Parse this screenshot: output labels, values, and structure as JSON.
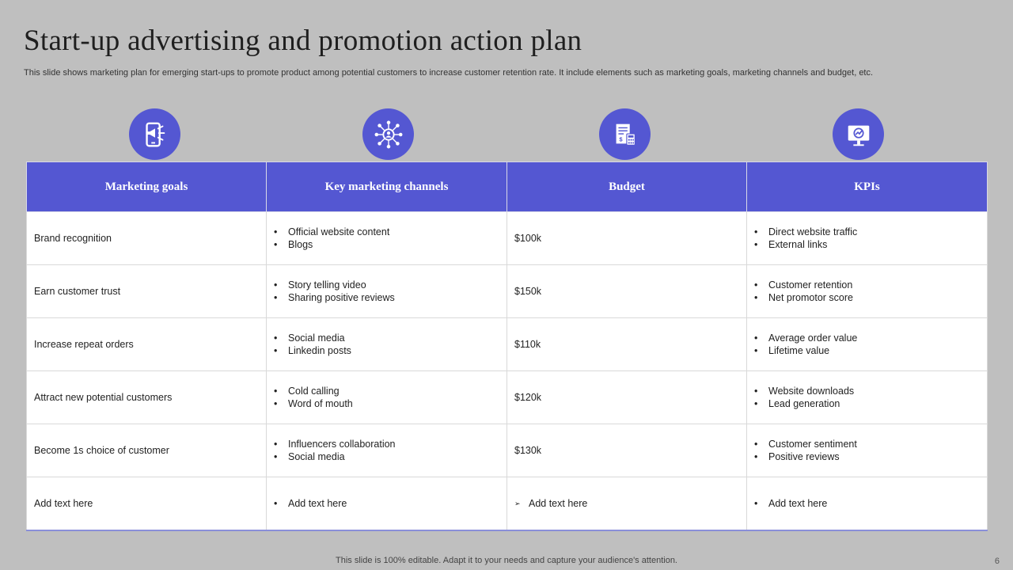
{
  "title": "Start-up advertising and promotion action plan",
  "subtitle": "This slide shows marketing plan for emerging start-ups to promote product among potential customers to increase customer retention rate. It include elements such as marketing goals, marketing channels and budget, etc.",
  "icons": [
    "megaphone-phone-icon",
    "network-person-icon",
    "budget-calculator-icon",
    "monitor-chart-icon"
  ],
  "colors": {
    "accent": "#5457d2",
    "background": "#bfbfbf"
  },
  "table": {
    "headers": [
      "Marketing goals",
      "Key marketing channels",
      "Budget",
      "KPIs"
    ],
    "rows": [
      {
        "goal": "Brand recognition",
        "channels": [
          "Official website content",
          "Blogs"
        ],
        "budget": "$100k",
        "kpis": [
          "Direct website traffic",
          "External links"
        ]
      },
      {
        "goal": "Earn customer trust",
        "channels": [
          "Story telling video",
          "Sharing positive reviews"
        ],
        "budget": "$150k",
        "kpis": [
          "Customer retention",
          "Net promotor score"
        ]
      },
      {
        "goal": "Increase repeat orders",
        "channels": [
          "Social media",
          "Linkedin posts"
        ],
        "budget": "$110k",
        "kpis": [
          "Average order value",
          "Lifetime value"
        ]
      },
      {
        "goal": "Attract new potential customers",
        "channels": [
          "Cold calling",
          "Word of mouth"
        ],
        "budget": "$120k",
        "kpis": [
          "Website downloads",
          "Lead generation"
        ]
      },
      {
        "goal": "Become 1s choice of customer",
        "channels": [
          "Influencers collaboration",
          "Social media"
        ],
        "budget": "$130k",
        "kpis": [
          "Customer sentiment",
          "Positive reviews"
        ]
      },
      {
        "goal": "Add text here",
        "channels": [
          "Add text here"
        ],
        "budget_list": [
          "Add text here"
        ],
        "kpis": [
          "Add text here"
        ]
      }
    ]
  },
  "footer": "This slide is 100% editable. Adapt it to your needs and capture your audience's attention.",
  "page_number": "6"
}
